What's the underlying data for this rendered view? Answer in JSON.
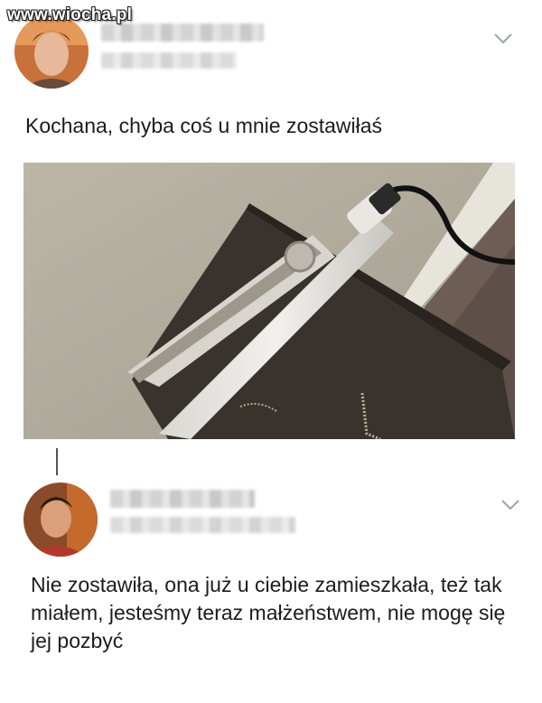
{
  "watermark": "www.wiocha.pl",
  "tweet1": {
    "text": "Kochana, chyba coś u mnie zostawiłaś",
    "avatar_icon": "profile-photo",
    "menu_icon": "chevron-down-icon"
  },
  "tweet2": {
    "text": "Nie zostawiła, ona już u ciebie zamieszkała, też tak miałem, jesteśmy teraz małżeństwem, nie mogę się jej pozbyć",
    "avatar_icon": "profile-photo",
    "menu_icon": "chevron-down-icon"
  },
  "colors": {
    "text": "#1c1c1c",
    "chevron": "#9aa4ad",
    "blur": "#d3d3d3"
  }
}
